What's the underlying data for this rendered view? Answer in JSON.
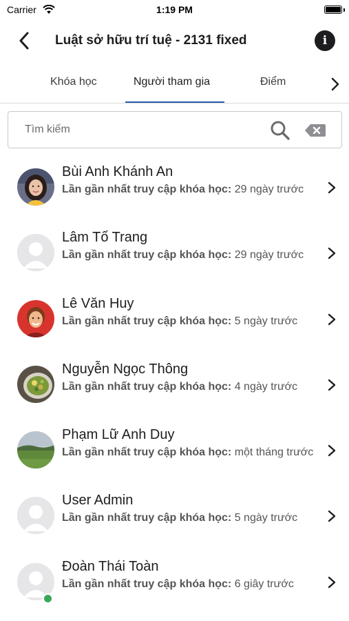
{
  "status_bar": {
    "carrier": "Carrier",
    "time": "1:19 PM"
  },
  "nav": {
    "title": "Luật sở hữu trí tuệ - 2131 fixed",
    "info_label": "i"
  },
  "tabs": [
    {
      "label": "Khóa học",
      "active": false
    },
    {
      "label": "Người tham gia",
      "active": true
    },
    {
      "label": "Điểm",
      "active": false
    }
  ],
  "search": {
    "placeholder": "Tìm kiếm"
  },
  "colors": {
    "accent": "#2a5bb0",
    "online": "#3aa757"
  },
  "participants": [
    {
      "name": "Bùi Anh Khánh An",
      "label": "Lần gần nhất truy cập khóa học:",
      "value": "29 ngày trước",
      "avatar": "photo-girl",
      "online": false
    },
    {
      "name": "Lâm Tố Trang",
      "label": "Lần gần nhất truy cập khóa học:",
      "value": "29 ngày trước",
      "avatar": "default-user",
      "online": false
    },
    {
      "name": "Lê Văn Huy",
      "label": "Lần gần nhất truy cập khóa học:",
      "value": "5 ngày trước",
      "avatar": "photo-boy-red",
      "online": false
    },
    {
      "name": "Nguyễn Ngọc Thông",
      "label": "Lần gần nhất truy cập khóa học:",
      "value": "4 ngày trước",
      "avatar": "photo-food",
      "online": false
    },
    {
      "name": "Phạm Lữ Anh Duy",
      "label": "Lần gần nhất truy cập khóa học:",
      "value": "một tháng trước",
      "avatar": "photo-landscape",
      "online": false
    },
    {
      "name": "User Admin",
      "label": "Lần gần nhất truy cập khóa học:",
      "value": "5 ngày trước",
      "avatar": "default-user",
      "online": false
    },
    {
      "name": "Đoàn Thái Toàn",
      "label": "Lần gần nhất truy cập khóa học:",
      "value": "6 giây trước",
      "avatar": "default-user",
      "online": true
    }
  ]
}
